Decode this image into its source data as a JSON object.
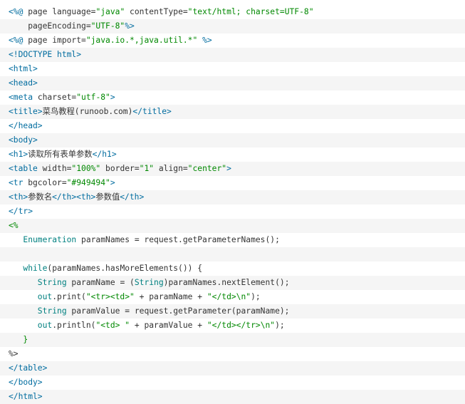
{
  "colors": {
    "tag": "#006c9f",
    "string": "#008800",
    "keyword": "#008080",
    "plain": "#333333",
    "punct": "#666600",
    "stripe": "#f5f5f5"
  },
  "code_lines": [
    [
      [
        "tag",
        "<%@"
      ],
      [
        "pl",
        " page language="
      ],
      [
        "str",
        "\"java\""
      ],
      [
        "pl",
        " contentType="
      ],
      [
        "str",
        "\"text/html; charset=UTF-8\""
      ]
    ],
    [
      [
        "pl",
        "    pageEncoding="
      ],
      [
        "str",
        "\"UTF-8\""
      ],
      [
        "tag",
        "%>"
      ]
    ],
    [
      [
        "tag",
        "<%@"
      ],
      [
        "pl",
        " page import="
      ],
      [
        "str",
        "\"java.io.*,java.util.*\""
      ],
      [
        "pl",
        " "
      ],
      [
        "tag",
        "%>"
      ]
    ],
    [
      [
        "tag",
        "<!DOCTYPE html>"
      ]
    ],
    [
      [
        "tag",
        "<html>"
      ]
    ],
    [
      [
        "tag",
        "<head>"
      ]
    ],
    [
      [
        "tag",
        "<meta"
      ],
      [
        "pl",
        " charset="
      ],
      [
        "str",
        "\"utf-8\""
      ],
      [
        "tag",
        ">"
      ]
    ],
    [
      [
        "tag",
        "<title>"
      ],
      [
        "pl",
        "菜鸟教程(runoob.com)"
      ],
      [
        "tag",
        "</title>"
      ]
    ],
    [
      [
        "tag",
        "</head>"
      ]
    ],
    [
      [
        "tag",
        "<body>"
      ]
    ],
    [
      [
        "tag",
        "<h1>"
      ],
      [
        "pl",
        "读取所有表单参数"
      ],
      [
        "tag",
        "</h1>"
      ]
    ],
    [
      [
        "tag",
        "<table"
      ],
      [
        "pl",
        " width="
      ],
      [
        "str",
        "\"100%\""
      ],
      [
        "pl",
        " border="
      ],
      [
        "str",
        "\"1\""
      ],
      [
        "pl",
        " align="
      ],
      [
        "str",
        "\"center\""
      ],
      [
        "tag",
        ">"
      ]
    ],
    [
      [
        "tag",
        "<tr"
      ],
      [
        "pl",
        " bgcolor="
      ],
      [
        "str",
        "\"#949494\""
      ],
      [
        "tag",
        ">"
      ]
    ],
    [
      [
        "tag",
        "<th>"
      ],
      [
        "pl",
        "参数名"
      ],
      [
        "tag",
        "</th><th>"
      ],
      [
        "pl",
        "参数值"
      ],
      [
        "tag",
        "</th>"
      ]
    ],
    [
      [
        "tag",
        "</tr>"
      ]
    ],
    [
      [
        "str",
        "<%"
      ]
    ],
    [
      [
        "kw",
        "   Enumeration"
      ],
      [
        "pl",
        " paramNames = request.getParameterNames();"
      ]
    ],
    [
      [
        "pl",
        ""
      ]
    ],
    [
      [
        "kw",
        "   while"
      ],
      [
        "pl",
        "(paramNames.hasMoreElements()) {"
      ]
    ],
    [
      [
        "kw",
        "      String"
      ],
      [
        "pl",
        " paramName = ("
      ],
      [
        "kw",
        "String"
      ],
      [
        "pl",
        ")paramNames.nextElement();"
      ]
    ],
    [
      [
        "kw",
        "      out"
      ],
      [
        "pl",
        ".print("
      ],
      [
        "str",
        "\"<tr><td>\""
      ],
      [
        "pl",
        " + paramName + "
      ],
      [
        "str",
        "\"</td>\\n\""
      ],
      [
        "pl",
        ");"
      ]
    ],
    [
      [
        "kw",
        "      String"
      ],
      [
        "pl",
        " paramValue = request.getParameter(paramName);"
      ]
    ],
    [
      [
        "kw",
        "      out"
      ],
      [
        "pl",
        ".println("
      ],
      [
        "str",
        "\"<td> \""
      ],
      [
        "pl",
        " + paramValue + "
      ],
      [
        "str",
        "\"</td></tr>\\n\""
      ],
      [
        "pl",
        ");"
      ]
    ],
    [
      [
        "str",
        "   }"
      ]
    ],
    [
      [
        "pl",
        "%>"
      ]
    ],
    [
      [
        "tag",
        "</table>"
      ]
    ],
    [
      [
        "tag",
        "</body>"
      ]
    ],
    [
      [
        "tag",
        "</html>"
      ]
    ]
  ]
}
